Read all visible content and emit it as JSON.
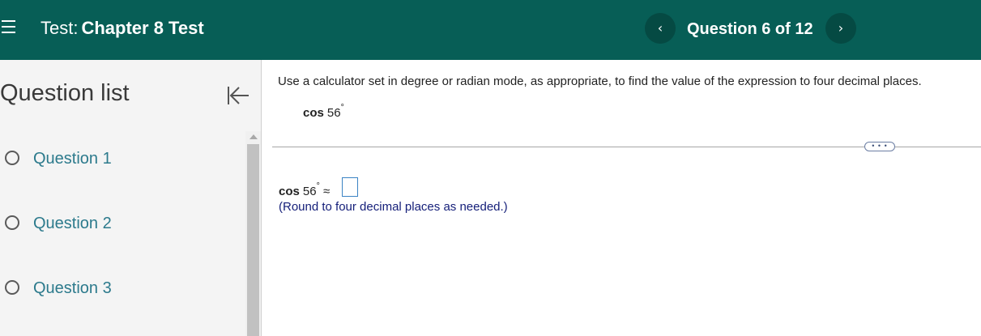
{
  "header": {
    "test_prefix": "Test:",
    "test_name": "Chapter 8 Test",
    "question_counter": "Question 6 of 12",
    "prev_glyph": "‹",
    "next_glyph": "›",
    "background_color": "#075e56"
  },
  "sidebar": {
    "title": "Question list",
    "questions": [
      {
        "label": "Question 1"
      },
      {
        "label": "Question 2"
      },
      {
        "label": "Question 3"
      }
    ]
  },
  "question": {
    "instructions": "Use a calculator set in degree or radian mode, as appropriate, to find the value of the expression to four decimal places.",
    "function": "cos",
    "angle": "56",
    "degree_symbol": "°",
    "approx_symbol": "≈",
    "more_label": "• • •",
    "answer_value": "",
    "round_note": "(Round to four decimal places as needed.)"
  }
}
